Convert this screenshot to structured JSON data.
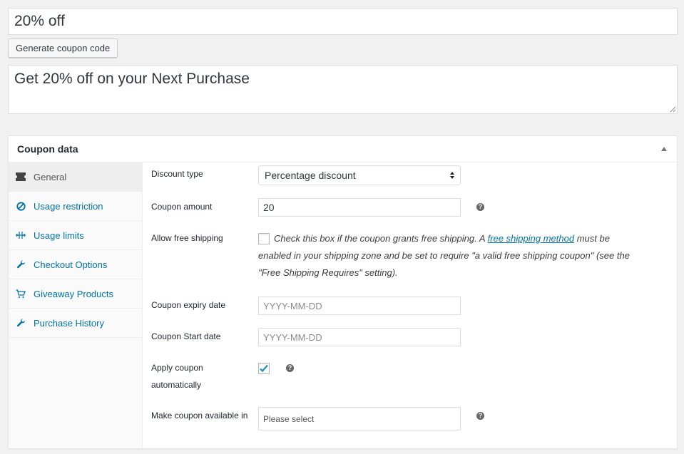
{
  "coupon_title": "20% off",
  "generate_button_label": "Generate coupon code",
  "coupon_description": "Get 20% off on your Next Purchase",
  "panel": {
    "title": "Coupon data",
    "tabs": [
      {
        "label": "General",
        "icon": "ticket-icon",
        "active": true
      },
      {
        "label": "Usage restriction",
        "icon": "blocked-icon",
        "active": false
      },
      {
        "label": "Usage limits",
        "icon": "limits-icon",
        "active": false
      },
      {
        "label": "Checkout Options",
        "icon": "wrench-icon",
        "active": false
      },
      {
        "label": "Giveaway Products",
        "icon": "cart-icon",
        "active": false
      },
      {
        "label": "Purchase History",
        "icon": "wrench-icon",
        "active": false
      }
    ]
  },
  "form": {
    "discount_type": {
      "label": "Discount type",
      "value": "Percentage discount"
    },
    "coupon_amount": {
      "label": "Coupon amount",
      "value": "20"
    },
    "free_shipping": {
      "label": "Allow free shipping",
      "checked": false,
      "desc_before": "Check this box if the coupon grants free shipping. A ",
      "link": "free shipping method",
      "desc_after": " must be",
      "desc_line2": "enabled in your shipping zone and be set to require \"a valid free shipping coupon\" (see the",
      "desc_line3": "\"Free Shipping Requires\" setting)."
    },
    "expiry_date": {
      "label": "Coupon expiry date",
      "placeholder": "YYYY-MM-DD"
    },
    "start_date": {
      "label": "Coupon Start date",
      "placeholder": "YYYY-MM-DD"
    },
    "apply_auto": {
      "label_line1": "Apply coupon",
      "label_line2": "automatically",
      "checked": true
    },
    "available_in": {
      "label": "Make coupon available in",
      "placeholder": "Please select"
    }
  },
  "colors": {
    "link": "#0073aa",
    "check": "#1e8cbe"
  }
}
